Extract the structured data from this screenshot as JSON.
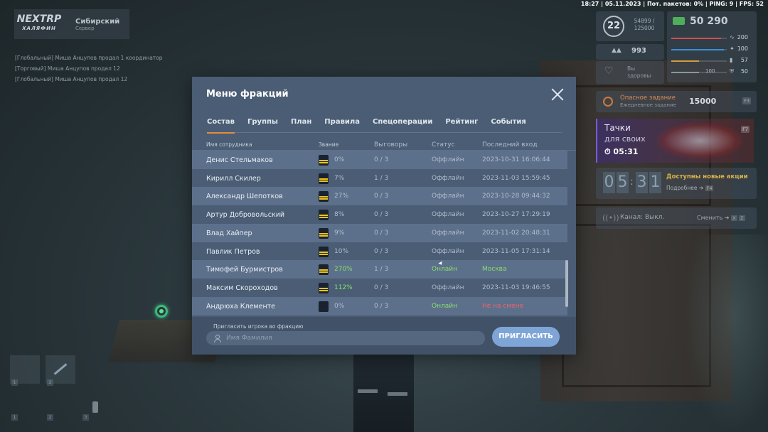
{
  "status_bar": "18:27 | 05.11.2023 | Пот. пакетов: 0% | PING: 9 | FPS: 52",
  "logo": {
    "mark_top": "NEXTRP",
    "mark_bottom": "ХАЛЯФИН",
    "server_name": "Сибирский",
    "server_id": "Сервер"
  },
  "chat": [
    "[Глобальный] Миша Анцупов продал 1 координатор",
    "[Торговый] Миша Анцупов продал 12",
    "[Глобальный] Миша Анцупов продал 12"
  ],
  "hud": {
    "level": "22",
    "xp": "54899 / 125000",
    "money": "50 290",
    "reputation": "993",
    "health_label": "Вы здоровы",
    "stats": [
      {
        "icon": "pulse-icon",
        "value": "200",
        "color": "#d2504e",
        "fill": 0.9
      },
      {
        "icon": "drop-icon",
        "value": "100",
        "color": "#3d8fd6",
        "fill": 0.95
      },
      {
        "icon": "food-icon",
        "value": "57",
        "color": "#d49a3e",
        "fill": 0.5
      },
      {
        "icon": "armor-icon",
        "value": "50",
        "extra": "100",
        "color": "#8a96a0",
        "fill": 0.5
      }
    ],
    "quest": {
      "title": "Опасное задание",
      "subtitle": "Ежедневное задание",
      "amount": "15000",
      "key": "F3"
    },
    "promo": {
      "line1": "Тачки",
      "line2": "для своих",
      "timer": "05:31",
      "key": "F7"
    },
    "timer": {
      "d1": "0",
      "d2": "5",
      "d3": "3",
      "d4": "1",
      "title": "Доступны новые акции",
      "details": "Подробнее",
      "key": "F4"
    },
    "radio": {
      "label": "Канал: Выкл.",
      "switch": "Сменить",
      "key1": "X",
      "key2": "Z"
    }
  },
  "slots": [
    "1",
    "2",
    "3",
    "1",
    "2"
  ],
  "modal": {
    "title": "Меню фракций",
    "tabs": [
      "Состав",
      "Группы",
      "План",
      "Правила",
      "Спецоперации",
      "Рейтинг",
      "События"
    ],
    "active_tab": "Состав",
    "columns": {
      "name": "Имя сотрудника",
      "rank": "Звание",
      "warnings": "Выговоры",
      "status": "Статус",
      "last": "Последний вход"
    },
    "rows": [
      {
        "name": "Денис Стельмаков",
        "pct": "0%",
        "warnings": "0 / 3",
        "status": "Оффлайн",
        "last": "2023-10-31 16:06:44",
        "online": false,
        "badge": true
      },
      {
        "name": "Кирилл Скилер",
        "pct": "7%",
        "warnings": "1 / 3",
        "status": "Оффлайн",
        "last": "2023-11-03 15:59:45",
        "online": false,
        "badge": true
      },
      {
        "name": "Александр Шепотков",
        "pct": "27%",
        "warnings": "0 / 3",
        "status": "Оффлайн",
        "last": "2023-10-28 09:44:32",
        "online": false,
        "badge": true
      },
      {
        "name": "Артур Добровольский",
        "pct": "8%",
        "warnings": "0 / 3",
        "status": "Оффлайн",
        "last": "2023-10-27 17:29:19",
        "online": false,
        "badge": true
      },
      {
        "name": "Влад Хайпер",
        "pct": "9%",
        "warnings": "0 / 3",
        "status": "Оффлайн",
        "last": "2023-11-02 20:48:31",
        "online": false,
        "badge": true
      },
      {
        "name": "Павлик Петров",
        "pct": "10%",
        "warnings": "0 / 3",
        "status": "Оффлайн",
        "last": "2023-11-05 17:31:14",
        "online": false,
        "badge": true
      },
      {
        "name": "Тимофей Бурмистров",
        "pct": "270%",
        "warnings": "1 / 3",
        "status": "Онлайн",
        "last": "Москва",
        "online": true,
        "badge": true,
        "pct_green": true,
        "last_color": "green"
      },
      {
        "name": "Максим Скороходов",
        "pct": "112%",
        "warnings": "0 / 3",
        "status": "Оффлайн",
        "last": "2023-11-03 19:46:55",
        "online": false,
        "badge": true,
        "pct_green": true
      },
      {
        "name": "Андрюха Клементе",
        "pct": "0%",
        "warnings": "0 / 3",
        "status": "Онлайн",
        "last": "Не на смене",
        "online": true,
        "badge": false,
        "last_color": "red"
      }
    ],
    "invite_label": "Пригласить игрока во фракцию",
    "invite_placeholder": "Имя Фамилия",
    "invite_button": "ПРИГЛАСИТЬ"
  },
  "colors": {
    "accent": "#e98a3a",
    "modal_bg": "#4a5d74",
    "online": "#86e06a",
    "warn": "#f2616b",
    "button": "#7ea5d6"
  }
}
